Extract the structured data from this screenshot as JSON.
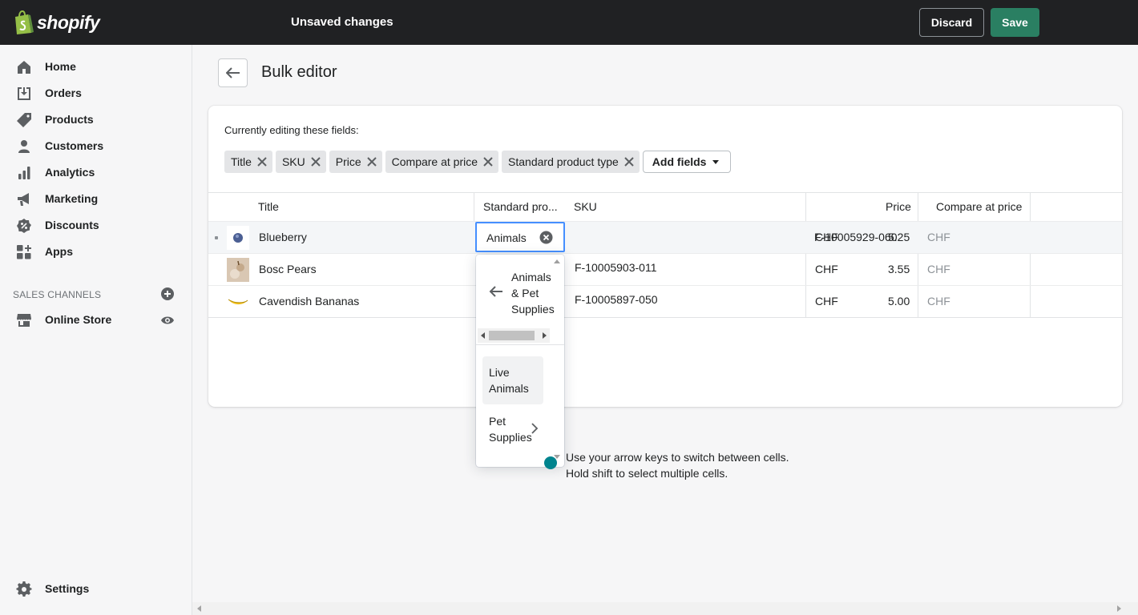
{
  "topbar": {
    "brand": "shopify",
    "status": "Unsaved changes",
    "discard_label": "Discard",
    "save_label": "Save"
  },
  "sidebar": {
    "items": [
      {
        "label": "Home",
        "icon": "home-icon"
      },
      {
        "label": "Orders",
        "icon": "orders-icon"
      },
      {
        "label": "Products",
        "icon": "tag-icon"
      },
      {
        "label": "Customers",
        "icon": "person-icon"
      },
      {
        "label": "Analytics",
        "icon": "bar-chart-icon"
      },
      {
        "label": "Marketing",
        "icon": "megaphone-icon"
      },
      {
        "label": "Discounts",
        "icon": "discount-icon"
      },
      {
        "label": "Apps",
        "icon": "apps-icon"
      }
    ],
    "sales_channels_title": "SALES CHANNELS",
    "online_store_label": "Online Store",
    "settings_label": "Settings"
  },
  "page": {
    "title": "Bulk editor",
    "editing_label": "Currently editing these fields:",
    "fields": [
      "Title",
      "SKU",
      "Price",
      "Compare at price",
      "Standard product type"
    ],
    "add_fields_label": "Add fields"
  },
  "grid": {
    "headers": {
      "title": "Title",
      "type": "Standard pro...",
      "sku": "SKU",
      "price": "Price",
      "compare": "Compare at price"
    },
    "rows": [
      {
        "title": "Blueberry",
        "type": "Animals",
        "sku": "F-10005929-060",
        "currency": "CHF",
        "price": "5.25",
        "compare_currency": "CHF"
      },
      {
        "title": "Bosc Pears",
        "type": "",
        "sku": "F-10005903-011",
        "currency": "CHF",
        "price": "3.55",
        "compare_currency": "CHF"
      },
      {
        "title": "Cavendish Bananas",
        "type": "",
        "sku": "F-10005897-050",
        "currency": "CHF",
        "price": "5.00",
        "compare_currency": "CHF"
      }
    ]
  },
  "dropdown": {
    "parent_line1": "Animals",
    "parent_line2": "& Pet",
    "parent_line3": "Supplies",
    "options": [
      {
        "line1": "Live",
        "line2": "Animals"
      },
      {
        "line1": "Pet",
        "line2": "Supplies"
      }
    ]
  },
  "hint": {
    "line1": "Use your arrow keys to switch between cells.",
    "line2": "Hold shift to select multiple cells."
  },
  "colors": {
    "topbar": "#202123",
    "save": "#2a7f62",
    "focus": "#458fff",
    "hint_icon": "#00848e"
  }
}
